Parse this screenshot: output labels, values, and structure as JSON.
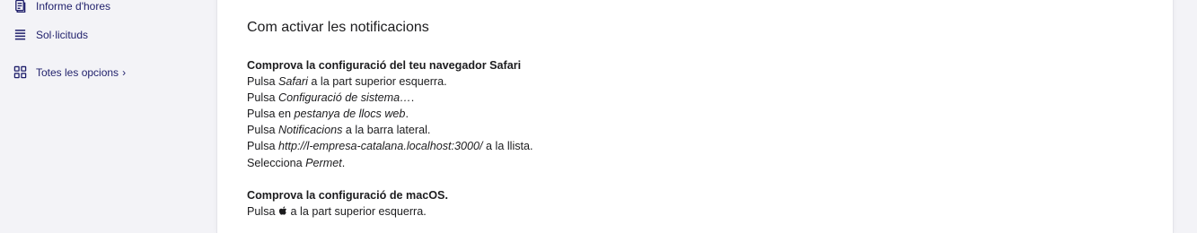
{
  "sidebar": {
    "items": [
      {
        "label": "Informe d'hores",
        "icon": "report-icon"
      },
      {
        "label": "Sol·licituds",
        "icon": "stack-icon"
      },
      {
        "label": "Totes les opcions",
        "icon": "grid-icon",
        "chevron": "›"
      }
    ]
  },
  "main": {
    "title": "Com activar les notificacions",
    "safari": {
      "title": "Comprova la configuració del teu navegador Safari",
      "steps": [
        {
          "pre": "Pulsa ",
          "em": "Safari",
          "post": " a la part superior esquerra."
        },
        {
          "pre": "Pulsa ",
          "em": "Configuració de sistema…",
          "post": "."
        },
        {
          "pre": "Pulsa en ",
          "em": "pestanya de llocs web",
          "post": "."
        },
        {
          "pre": "Pulsa ",
          "em": "Notificacions",
          "post": " a la barra lateral."
        },
        {
          "pre": "Pulsa ",
          "em": "http://l-empresa-catalana.localhost:3000/",
          "post": " a la llista."
        },
        {
          "pre": "Selecciona ",
          "em": "Permet",
          "post": "."
        }
      ]
    },
    "macos": {
      "title": "Comprova la configuració de macOS.",
      "step_pre": "Pulsa ",
      "step_icon": "apple-icon",
      "step_post": " a la part superior esquerra."
    }
  },
  "colors": {
    "nav_text": "#1f1f6b",
    "background": "#f3f3f7",
    "panel": "#ffffff"
  }
}
